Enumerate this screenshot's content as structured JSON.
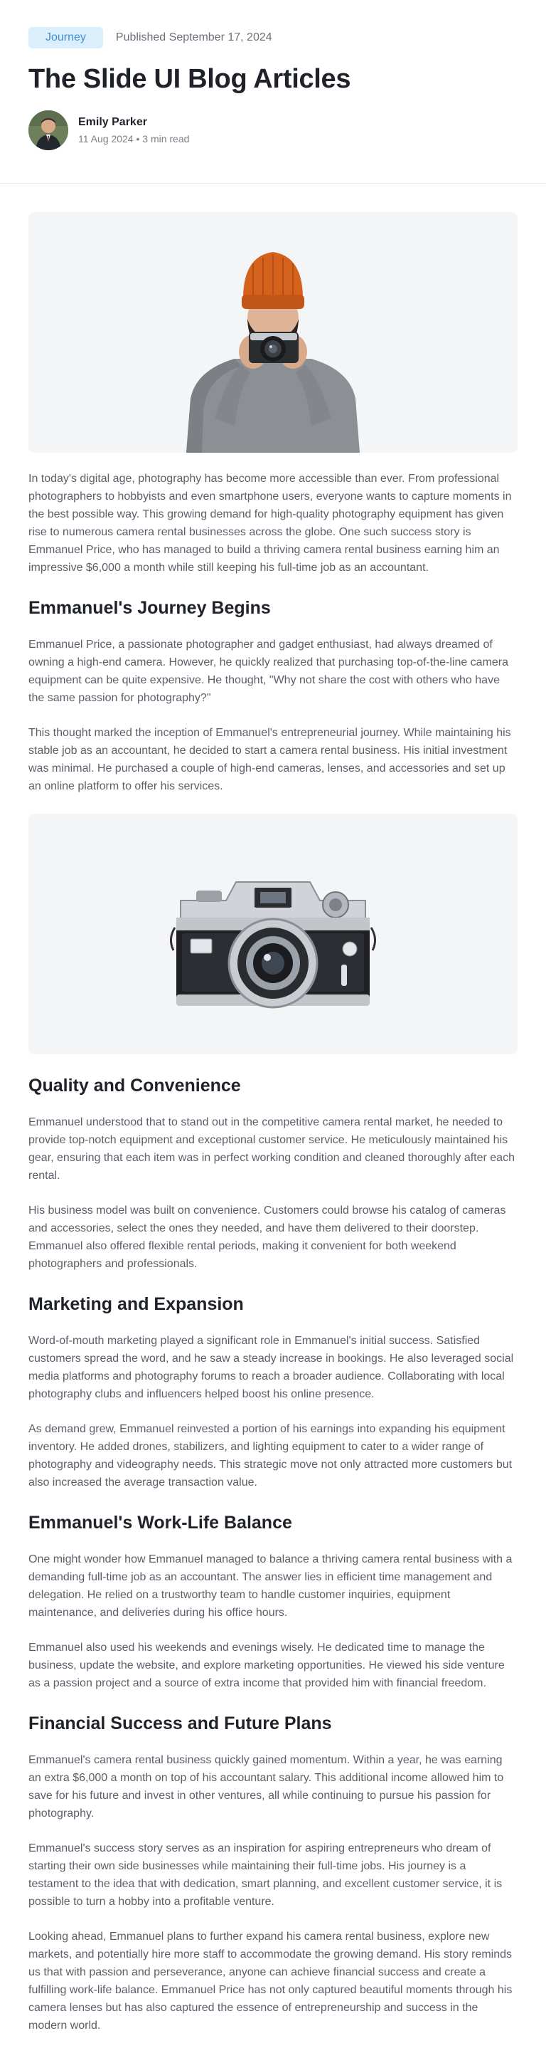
{
  "header": {
    "tag": "Journey",
    "published": "Published September 17, 2024",
    "title": "The Slide UI Blog Articles",
    "author_name": "Emily Parker",
    "author_meta": "11 Aug 2024 • 3 min read"
  },
  "article": {
    "intro": "In today's digital age, photography has become more accessible than ever. From professional photographers to hobbyists and even smartphone users, everyone wants to capture moments in the best possible way. This growing demand for high-quality photography equipment has given rise to numerous camera rental businesses across the globe. One such success story is Emmanuel Price, who has managed to build a thriving camera rental business earning him an impressive $6,000 a month while still keeping his full-time job as an accountant.",
    "sections": [
      {
        "heading": "Emmanuel's Journey Begins",
        "paragraphs": [
          "Emmanuel Price, a passionate photographer and gadget enthusiast, had always dreamed of owning a high-end camera. However, he quickly realized that purchasing top-of-the-line camera equipment can be quite expensive. He thought, \"Why not share the cost with others who have the same passion for photography?\"",
          "This thought marked the inception of Emmanuel's entrepreneurial journey. While maintaining his stable job as an accountant, he decided to start a camera rental business. His initial investment was minimal. He purchased a couple of high-end cameras, lenses, and accessories and set up an online platform to offer his services."
        ]
      },
      {
        "heading": "Quality and Convenience",
        "paragraphs": [
          "Emmanuel understood that to stand out in the competitive camera rental market, he needed to provide top-notch equipment and exceptional customer service. He meticulously maintained his gear, ensuring that each item was in perfect working condition and cleaned thoroughly after each rental.",
          "His business model was built on convenience. Customers could browse his catalog of cameras and accessories, select the ones they needed, and have them delivered to their doorstep. Emmanuel also offered flexible rental periods, making it convenient for both weekend photographers and professionals."
        ]
      },
      {
        "heading": "Marketing and Expansion",
        "paragraphs": [
          "Word-of-mouth marketing played a significant role in Emmanuel's initial success. Satisfied customers spread the word, and he saw a steady increase in bookings. He also leveraged social media platforms and photography forums to reach a broader audience. Collaborating with local photography clubs and influencers helped boost his online presence.",
          "As demand grew, Emmanuel reinvested a portion of his earnings into expanding his equipment inventory. He added drones, stabilizers, and lighting equipment to cater to a wider range of photography and videography needs. This strategic move not only attracted more customers but also increased the average transaction value."
        ]
      },
      {
        "heading": "Emmanuel's Work-Life Balance",
        "paragraphs": [
          "One might wonder how Emmanuel managed to balance a thriving camera rental business with a demanding full-time job as an accountant. The answer lies in efficient time management and delegation. He relied on a trustworthy team to handle customer inquiries, equipment maintenance, and deliveries during his office hours.",
          "Emmanuel also used his weekends and evenings wisely. He dedicated time to manage the business, update the website, and explore marketing opportunities. He viewed his side venture as a passion project and a source of extra income that provided him with financial freedom."
        ]
      },
      {
        "heading": "Financial Success and Future Plans",
        "paragraphs": [
          "Emmanuel's camera rental business quickly gained momentum. Within a year, he was earning an extra $6,000 a month on top of his accountant salary. This additional income allowed him to save for his future and invest in other ventures, all while continuing to pursue his passion for photography.",
          "Emmanuel's success story serves as an inspiration for aspiring entrepreneurs who dream of starting their own side businesses while maintaining their full-time jobs. His journey is a testament to the idea that with dedication, smart planning, and excellent customer service, it is possible to turn a hobby into a profitable venture.",
          "Looking ahead, Emmanuel plans to further expand his camera rental business, explore new markets, and potentially hire more staff to accommodate the growing demand. His story reminds us that with passion and perseverance, anyone can achieve financial success and create a fulfilling work-life balance. Emmanuel Price has not only captured beautiful moments through his camera lenses but has also captured the essence of entrepreneurship and success in the modern world."
        ]
      }
    ]
  },
  "colors": {
    "tag_bg": "#dbeefb",
    "tag_text": "#3f8fd6",
    "beanie": "#d4621d",
    "sweater": "#8c8f94"
  },
  "icons": {
    "avatar": "author-avatar",
    "hero_image": "photographer-with-camera-photo",
    "camera_image": "vintage-camera-photo"
  }
}
